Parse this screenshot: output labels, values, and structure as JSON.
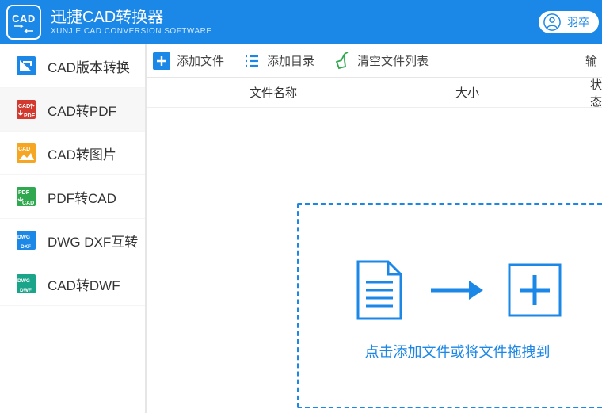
{
  "header": {
    "logo_text": "CAD",
    "title": "迅捷CAD转换器",
    "subtitle": "XUNJIE CAD CONVERSION SOFTWARE",
    "user_name": "羽卒"
  },
  "sidebar": {
    "items": [
      {
        "label": "CAD版本转换"
      },
      {
        "label": "CAD转PDF"
      },
      {
        "label": "CAD转图片"
      },
      {
        "label": "PDF转CAD"
      },
      {
        "label": "DWG DXF互转"
      },
      {
        "label": "CAD转DWF"
      }
    ]
  },
  "toolbar": {
    "add_file": "添加文件",
    "add_dir": "添加目录",
    "clear_list": "清空文件列表",
    "output": "输"
  },
  "table": {
    "col_name": "文件名称",
    "col_size": "大小",
    "col_status": "状态"
  },
  "drop": {
    "hint": "点击添加文件或将文件拖拽到"
  }
}
